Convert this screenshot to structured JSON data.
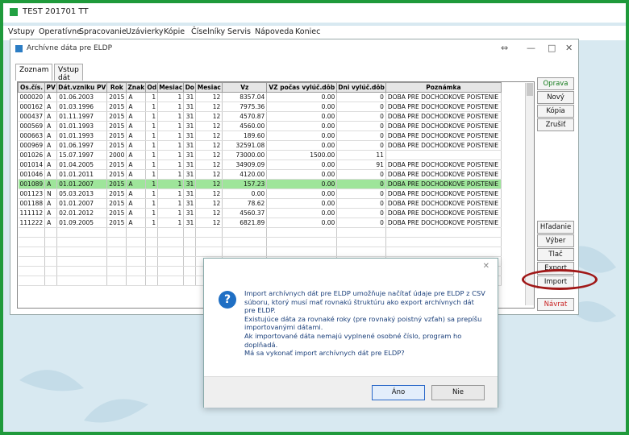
{
  "app": {
    "title": "TEST 201701 TT",
    "menu": [
      "Vstupy",
      "Operatívne",
      "Spracovanie",
      "Uzávierky",
      "Kópie",
      "Číselníky",
      "Servis",
      "Nápoveda",
      "Koniec"
    ]
  },
  "child_window": {
    "title": "Archívne dáta pre ELDP",
    "tabs": [
      "Zoznam",
      "Vstup dát"
    ],
    "columns": [
      "Os.čís.",
      "PV",
      "Dát.vzniku PV",
      "Rok",
      "Znak",
      "Od",
      "Mesiac",
      "Do",
      "Mesiac",
      "Vz",
      "VZ počas vylúč.dôb",
      "Dni vylúč.dôb",
      "Poznámka"
    ],
    "rows": [
      [
        "000020",
        "A",
        "01.06.2003",
        "2015",
        "A",
        "1",
        "1",
        "31",
        "12",
        "8357.04",
        "0.00",
        "0",
        "DOBA PRE DOCHODKOVE POISTENIE"
      ],
      [
        "000162",
        "A",
        "01.03.1996",
        "2015",
        "A",
        "1",
        "1",
        "31",
        "12",
        "7975.36",
        "0.00",
        "0",
        "DOBA PRE DOCHODKOVE POISTENIE"
      ],
      [
        "000437",
        "A",
        "01.11.1997",
        "2015",
        "A",
        "1",
        "1",
        "31",
        "12",
        "4570.87",
        "0.00",
        "0",
        "DOBA PRE DOCHODKOVE POISTENIE"
      ],
      [
        "000569",
        "A",
        "01.01.1993",
        "2015",
        "A",
        "1",
        "1",
        "31",
        "12",
        "4560.00",
        "0.00",
        "0",
        "DOBA PRE DOCHODKOVE POISTENIE"
      ],
      [
        "000663",
        "A",
        "01.01.1993",
        "2015",
        "A",
        "1",
        "1",
        "31",
        "12",
        "189.60",
        "0.00",
        "0",
        "DOBA PRE DOCHODKOVE POISTENIE"
      ],
      [
        "000969",
        "A",
        "01.06.1997",
        "2015",
        "A",
        "1",
        "1",
        "31",
        "12",
        "32591.08",
        "0.00",
        "0",
        "DOBA PRE DOCHODKOVE POISTENIE"
      ],
      [
        "001026",
        "A",
        "15.07.1997",
        "2000",
        "A",
        "1",
        "1",
        "31",
        "12",
        "73000.00",
        "1500.00",
        "11",
        ""
      ],
      [
        "001014",
        "A",
        "01.04.2005",
        "2015",
        "A",
        "1",
        "1",
        "31",
        "12",
        "34909.09",
        "0.00",
        "91",
        "DOBA PRE DOCHODKOVE POISTENIE"
      ],
      [
        "001046",
        "A",
        "01.01.2011",
        "2015",
        "A",
        "1",
        "1",
        "31",
        "12",
        "4120.00",
        "0.00",
        "0",
        "DOBA PRE DOCHODKOVE POISTENIE"
      ],
      [
        "001089",
        "A",
        "01.01.2007",
        "2015",
        "A",
        "1",
        "1",
        "31",
        "12",
        "157.23",
        "0.00",
        "0",
        "DOBA PRE DOCHODKOVE POISTENIE"
      ],
      [
        "001123",
        "N",
        "05.03.2013",
        "2015",
        "A",
        "1",
        "1",
        "31",
        "12",
        "0.00",
        "0.00",
        "0",
        "DOBA PRE DOCHODKOVE POISTENIE"
      ],
      [
        "001188",
        "A",
        "01.01.2007",
        "2015",
        "A",
        "1",
        "1",
        "31",
        "12",
        "78.62",
        "0.00",
        "0",
        "DOBA PRE DOCHODKOVE POISTENIE"
      ],
      [
        "111112",
        "A",
        "02.01.2012",
        "2015",
        "A",
        "1",
        "1",
        "31",
        "12",
        "4560.37",
        "0.00",
        "0",
        "DOBA PRE DOCHODKOVE POISTENIE"
      ],
      [
        "111222",
        "A",
        "01.09.2005",
        "2015",
        "A",
        "1",
        "1",
        "31",
        "12",
        "6821.89",
        "0.00",
        "0",
        "DOBA PRE DOCHODKOVE POISTENIE"
      ]
    ],
    "selected_row_index": 9,
    "buttons": {
      "oprava": "Oprava",
      "novy": "Nový",
      "kopia": "Kópia",
      "zrusit": "Zrušiť",
      "hladanie": "Hľadanie",
      "vyber": "Výber",
      "tlac": "Tlač",
      "export": "Export",
      "import": "Import",
      "navrat": "Návrat"
    }
  },
  "dialog": {
    "lines": [
      "Import archívnych dát pre ELDP umožňuje načítať údaje pre ELDP z CSV súboru, ktorý musí mať rovnakú štruktúru ako export archívnych dát pre ELDP.",
      "Existujúce dáta za rovnaké roky (pre rovnaký poistný vzťah) sa prepíšu importovanými dátami.",
      "Ak importované dáta nemajú vyplnené osobné číslo, program ho doplňadá.",
      "Má sa vykonať import archívnych dát pre ELDP?"
    ],
    "yes": "Áno",
    "no": "Nie"
  },
  "colors": {
    "selected_row": "#9ee59a",
    "accent_red": "#a01818",
    "bg_green": "#1f9a3b"
  }
}
